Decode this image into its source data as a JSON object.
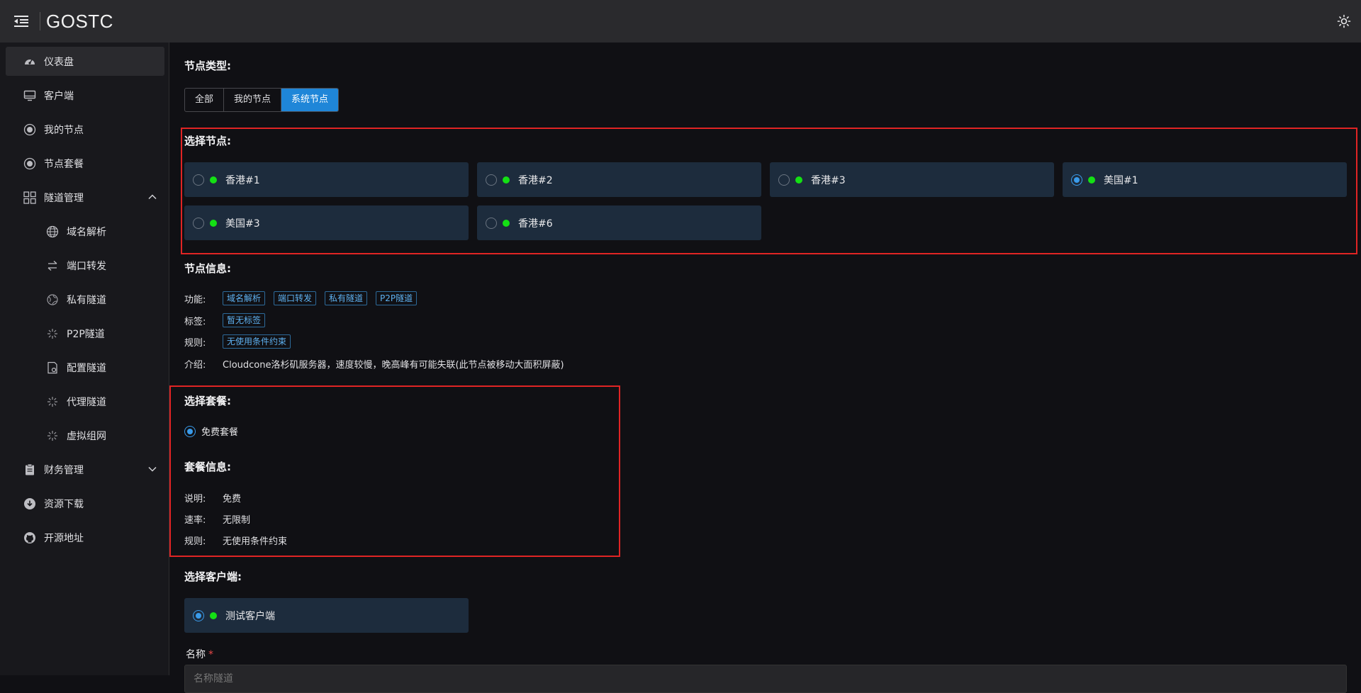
{
  "header": {
    "app_title": "GOSTC",
    "menu_icon": "menu-fold-icon",
    "theme_icon": "sun-icon"
  },
  "sidebar": {
    "items": [
      {
        "label": "仪表盘",
        "icon": "dashboard-icon",
        "active": true
      },
      {
        "label": "客户端",
        "icon": "monitor-icon"
      },
      {
        "label": "我的节点",
        "icon": "radio-node-icon"
      },
      {
        "label": "节点套餐",
        "icon": "radio-node-icon"
      },
      {
        "label": "隧道管理",
        "icon": "grid-icon",
        "expanded": true
      },
      {
        "label": "域名解析",
        "icon": "globe-icon"
      },
      {
        "label": "端口转发",
        "icon": "swap-icon"
      },
      {
        "label": "私有隧道",
        "icon": "network-globe-icon"
      },
      {
        "label": "P2P隧道",
        "icon": "burst-icon"
      },
      {
        "label": "配置隧道",
        "icon": "config-file-icon"
      },
      {
        "label": "代理隧道",
        "icon": "burst-icon"
      },
      {
        "label": "虚拟组网",
        "icon": "burst-icon"
      },
      {
        "label": "财务管理",
        "icon": "clipboard-icon",
        "expanded": false
      },
      {
        "label": "资源下载",
        "icon": "download-icon"
      },
      {
        "label": "开源地址",
        "icon": "github-icon"
      }
    ]
  },
  "node_type": {
    "title": "节点类型:",
    "options": [
      "全部",
      "我的节点",
      "系统节点"
    ],
    "selected": "系统节点"
  },
  "node_select": {
    "title": "选择节点:",
    "nodes": [
      {
        "name": "香港#1",
        "online": true,
        "selected": false
      },
      {
        "name": "香港#2",
        "online": true,
        "selected": false
      },
      {
        "name": "香港#3",
        "online": true,
        "selected": false
      },
      {
        "name": "美国#1",
        "online": true,
        "selected": true
      },
      {
        "name": "美国#3",
        "online": true,
        "selected": false
      },
      {
        "name": "香港#6",
        "online": true,
        "selected": false
      }
    ]
  },
  "node_info": {
    "title": "节点信息:",
    "function_label": "功能:",
    "functions": [
      "域名解析",
      "端口转发",
      "私有隧道",
      "P2P隧道"
    ],
    "tags_label": "标签:",
    "tags": [
      "暂无标签"
    ],
    "rules_label": "规则:",
    "rules": [
      "无使用条件约束"
    ],
    "intro_label": "介绍:",
    "intro": "Cloudcone洛杉矶服务器，速度较慢，晚高峰有可能失联(此节点被移动大面积屏蔽)"
  },
  "plan_select": {
    "title": "选择套餐:",
    "option": "免费套餐",
    "selected": true
  },
  "plan_info": {
    "title": "套餐信息:",
    "desc_label": "说明:",
    "desc": "免费",
    "rate_label": "速率:",
    "rate": "无限制",
    "rules_label": "规则:",
    "rules": "无使用条件约束"
  },
  "client_select": {
    "title": "选择客户端:",
    "clients": [
      {
        "name": "测试客户端",
        "online": true,
        "selected": true
      }
    ]
  },
  "name_field": {
    "label": "名称",
    "required_mark": "*",
    "placeholder": "名称隧道"
  },
  "colors": {
    "accent": "#1f86d8",
    "online": "#14e014",
    "highlight_box": "#e02424",
    "card_bg": "#1d2c3d"
  }
}
